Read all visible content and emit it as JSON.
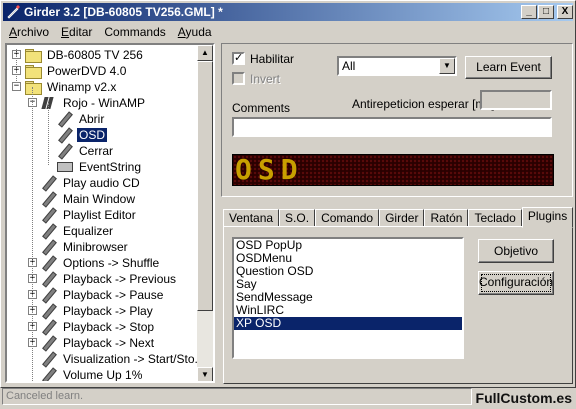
{
  "app": {
    "title": "Girder 3.2 [DB-60805 TV256.GML] *",
    "window_controls": {
      "minimize": "_",
      "maximize": "□",
      "close": "X"
    }
  },
  "menubar": [
    {
      "label": "Archivo",
      "accel": "A"
    },
    {
      "label": "Editar",
      "accel": "E"
    },
    {
      "label": "Commands",
      "accel": ""
    },
    {
      "label": "Ayuda",
      "accel": "A"
    }
  ],
  "tree": {
    "items": [
      {
        "label": "DB-60805 TV 256",
        "icon": "folder-icon",
        "expander": "+"
      },
      {
        "label": "PowerDVD 4.0",
        "icon": "folder-icon",
        "expander": "+"
      },
      {
        "label": "Winamp v2.x",
        "icon": "folder-icon",
        "expander": "−"
      },
      {
        "label": "Rojo - WinAMP",
        "icon": "multigroup-icon",
        "expander": "−"
      },
      {
        "label": "Abrir",
        "icon": "command-icon"
      },
      {
        "label": "OSD",
        "icon": "command-icon",
        "selected": true
      },
      {
        "label": "Cerrar",
        "icon": "command-icon"
      },
      {
        "label": "EventString",
        "icon": "keyboard-icon"
      },
      {
        "label": "Play audio CD",
        "icon": "command-icon"
      },
      {
        "label": "Main Window",
        "icon": "command-icon"
      },
      {
        "label": "Playlist Editor",
        "icon": "command-icon"
      },
      {
        "label": "Equalizer",
        "icon": "command-icon"
      },
      {
        "label": "Minibrowser",
        "icon": "command-icon"
      },
      {
        "label": "Options -> Shuffle",
        "icon": "command-icon",
        "expander": "+"
      },
      {
        "label": "Playback -> Previous",
        "icon": "command-icon",
        "expander": "+"
      },
      {
        "label": "Playback -> Pause",
        "icon": "command-icon",
        "expander": "+"
      },
      {
        "label": "Playback -> Play",
        "icon": "command-icon",
        "expander": "+"
      },
      {
        "label": "Playback -> Stop",
        "icon": "command-icon",
        "expander": "+"
      },
      {
        "label": "Playback -> Next",
        "icon": "command-icon",
        "expander": "+"
      },
      {
        "label": "Visualization -> Start/Sto...",
        "icon": "command-icon"
      },
      {
        "label": "Volume Up 1%",
        "icon": "command-icon"
      }
    ]
  },
  "settings": {
    "enable_label": "Habilitar",
    "enable_checked": true,
    "invert_label": "Invert",
    "invert_checked": false,
    "event_select": "All",
    "learn_event_button": "Learn Event",
    "repeat_label": "Antirepeticion esperar [ms]",
    "repeat_value": "",
    "comments_label": "Comments",
    "comments_value": "",
    "led_display_text": "OSD"
  },
  "tabs": [
    {
      "label": "Ventana"
    },
    {
      "label": "S.O."
    },
    {
      "label": "Comando"
    },
    {
      "label": "Girder"
    },
    {
      "label": "Ratón"
    },
    {
      "label": "Teclado"
    },
    {
      "label": "Plugins",
      "active": true
    }
  ],
  "plugins": {
    "items": [
      "OSD PopUp",
      "OSDMenu",
      "Question OSD",
      "Say",
      "SendMessage",
      "WinLIRC",
      "XP OSD"
    ],
    "selected_index": 6,
    "target_button": "Objetivo",
    "config_button": "Configuración"
  },
  "status": {
    "text": "Canceled learn."
  },
  "watermark": "FullCustom.es"
}
